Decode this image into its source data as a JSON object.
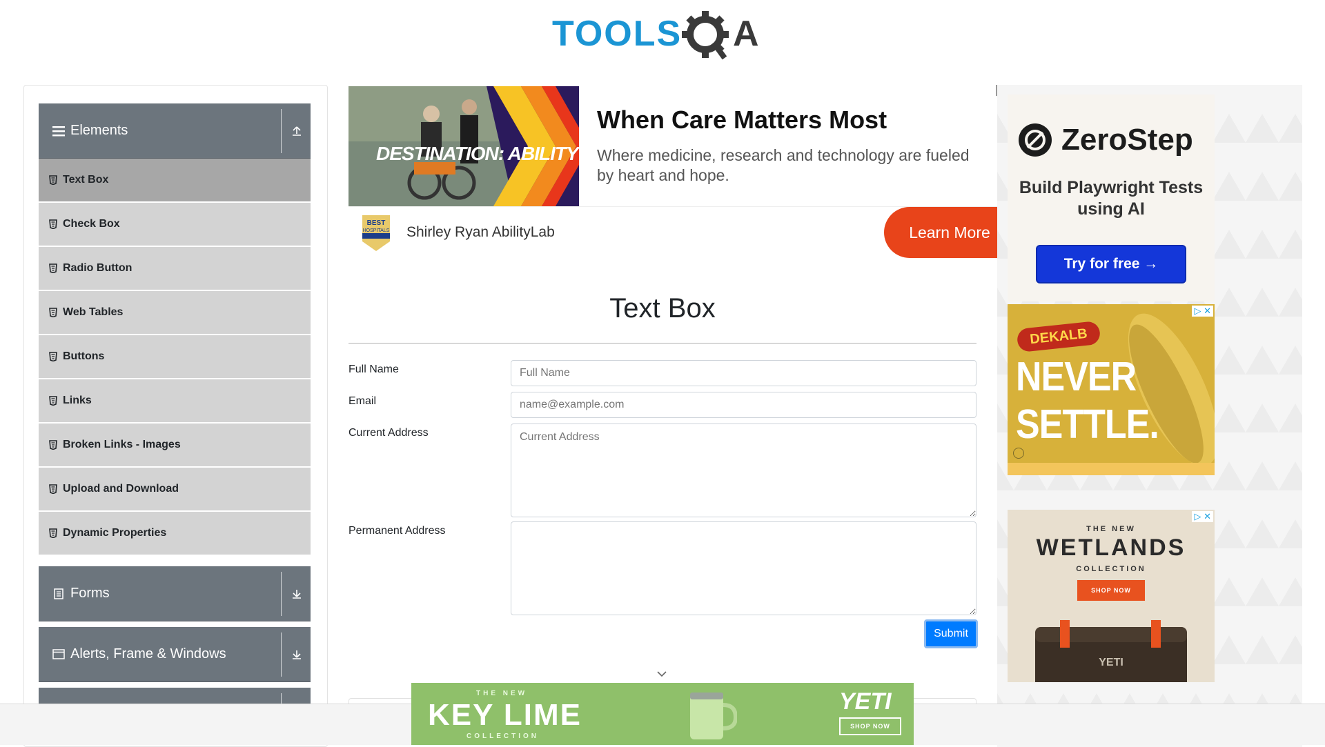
{
  "header": {
    "logo_text_left": "TOOLS",
    "logo_text_right": "A"
  },
  "sidebar": {
    "groups": [
      {
        "title": "Elements",
        "icon": "hamburger-icon",
        "toggle": "arrow-up-icon",
        "expanded": true
      },
      {
        "title": "Forms",
        "icon": "document-icon",
        "toggle": "arrow-down-icon",
        "expanded": false
      },
      {
        "title": "Alerts, Frame & Windows",
        "icon": "window-icon",
        "toggle": "arrow-down-icon",
        "expanded": false
      }
    ],
    "items": [
      {
        "label": "Text Box",
        "active": true
      },
      {
        "label": "Check Box"
      },
      {
        "label": "Radio Button"
      },
      {
        "label": "Web Tables"
      },
      {
        "label": "Buttons"
      },
      {
        "label": "Links"
      },
      {
        "label": "Broken Links - Images"
      },
      {
        "label": "Upload and Download"
      },
      {
        "label": "Dynamic Properties"
      }
    ]
  },
  "ad_top": {
    "image_text": "DESTINATION: ABILITY",
    "headline": "When Care Matters Most",
    "subtext": "Where medicine, research and technology are fueled by heart and hope.",
    "brand": "Shirley Ryan AbilityLab",
    "cta": "Learn More",
    "badge_text": "BEST HOSPITALS"
  },
  "main": {
    "title": "Text Box",
    "fields": {
      "full_name": {
        "label": "Full Name",
        "placeholder": "Full Name",
        "value": ""
      },
      "email": {
        "label": "Email",
        "placeholder": "name@example.com",
        "value": ""
      },
      "current_address": {
        "label": "Current Address",
        "placeholder": "Current Address",
        "value": ""
      },
      "permanent_address": {
        "label": "Permanent Address",
        "placeholder": "",
        "value": ""
      }
    },
    "submit_label": "Submit"
  },
  "rail_ads": {
    "zerostep": {
      "brand": "ZeroStep",
      "tagline": "Build Playwright Tests using AI",
      "cta": "Try for free →"
    },
    "dekalb": {
      "brand": "DEKALB",
      "headline": "NEVER SETTLE."
    },
    "wetlands": {
      "kicker": "THE NEW",
      "title": "WETLANDS",
      "sub": "COLLECTION",
      "cta": "SHOP NOW"
    }
  },
  "bottom_ad": {
    "kicker": "THE NEW",
    "title": "KEY LIME",
    "sub": "COLLECTION",
    "brand": "YETI",
    "cta": "SHOP NOW"
  },
  "colors": {
    "sidebar_header": "#6c757d",
    "menu_item": "#d3d3d3",
    "menu_active": "#a7a7a7",
    "submit": "#007bff",
    "cta_orange": "#e8441a"
  }
}
